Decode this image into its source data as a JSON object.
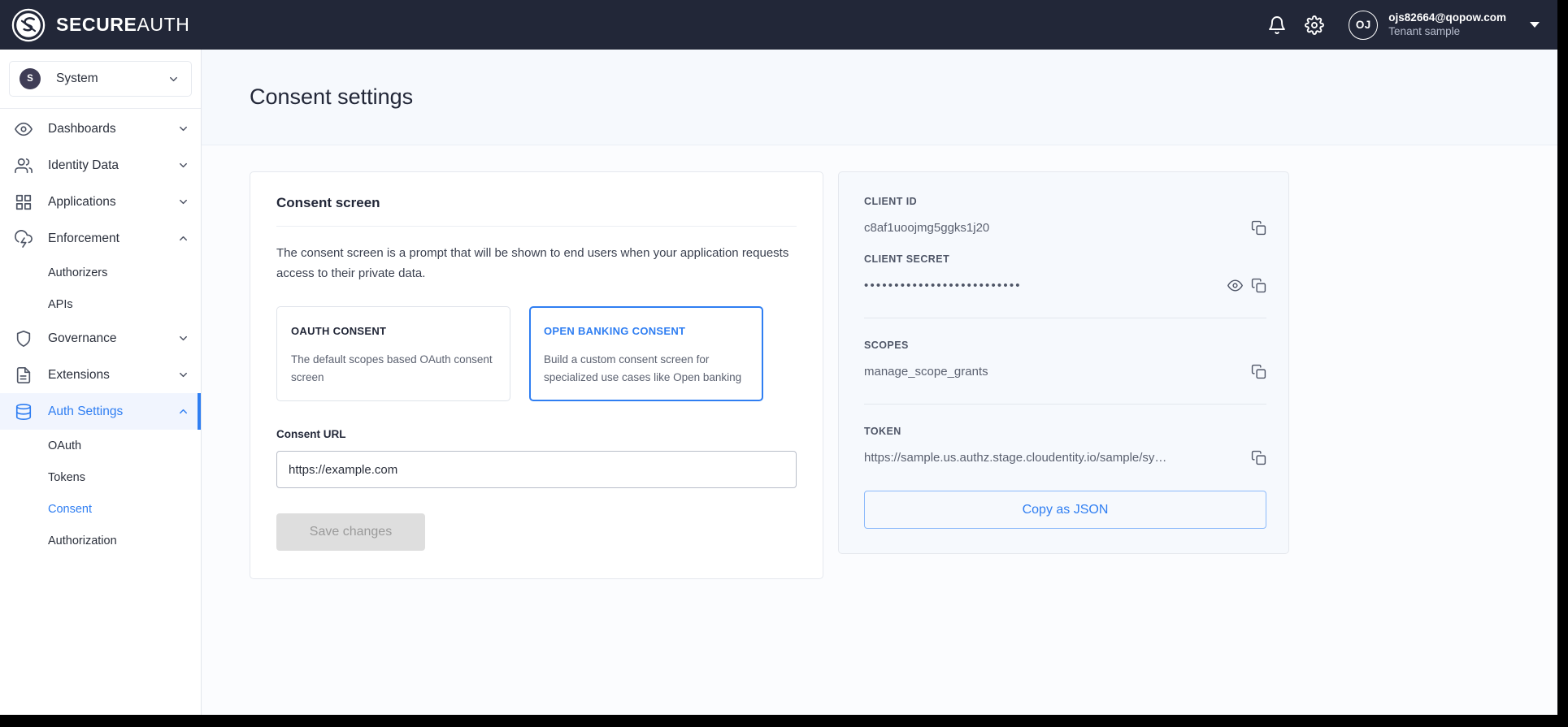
{
  "topbar": {
    "brand_bold": "SECURE",
    "brand_light": "AUTH",
    "logo_icon": "secureauth-logo-icon",
    "notifications_icon": "bell-icon",
    "settings_icon": "gear-icon",
    "avatar_initials": "OJ",
    "user_email": "ojs82664@qopow.com",
    "tenant_line": "Tenant sample"
  },
  "sidebar": {
    "tenant": {
      "initial": "S",
      "label": "System"
    },
    "items": [
      {
        "label": "Dashboards",
        "icon": "eye-icon",
        "expanded": false
      },
      {
        "label": "Identity Data",
        "icon": "users-icon",
        "expanded": false
      },
      {
        "label": "Applications",
        "icon": "grid-icon",
        "expanded": false
      },
      {
        "label": "Enforcement",
        "icon": "cloud-lightning-icon",
        "expanded": true
      },
      {
        "label": "Governance",
        "icon": "shield-icon",
        "expanded": false
      },
      {
        "label": "Extensions",
        "icon": "file-text-icon",
        "expanded": false
      },
      {
        "label": "Auth Settings",
        "icon": "database-icon",
        "expanded": true
      }
    ],
    "enforcement_children": [
      "Authorizers",
      "APIs"
    ],
    "auth_settings_children": [
      "OAuth",
      "Tokens",
      "Consent",
      "Authorization"
    ],
    "active_item": "Auth Settings",
    "selected_child": "Consent"
  },
  "page": {
    "title": "Consent settings"
  },
  "consent_card": {
    "title": "Consent screen",
    "description": "The consent screen is a prompt that will be shown to end users when your application requests access to their private data.",
    "options": [
      {
        "title": "OAUTH CONSENT",
        "description": "The default scopes based OAuth consent screen",
        "selected": false
      },
      {
        "title": "OPEN BANKING CONSENT",
        "description": "Build a custom consent screen for specialized use cases like Open banking",
        "selected": true
      }
    ],
    "url_label": "Consent URL",
    "url_value": "https://example.com",
    "url_placeholder": "https://example.com",
    "save_label": "Save changes"
  },
  "details_card": {
    "client_id_label": "CLIENT ID",
    "client_id_value": "c8af1uoojmg5ggks1j20",
    "client_secret_label": "CLIENT SECRET",
    "client_secret_masked": "••••••••••••••••••••••••••",
    "scopes_label": "SCOPES",
    "scopes_value": "manage_scope_grants",
    "token_label": "TOKEN",
    "token_value": "https://sample.us.authz.stage.cloudentity.io/sample/sy…",
    "copy_icon": "copy-icon",
    "reveal_icon": "eye-icon",
    "copy_json_label": "Copy as JSON"
  },
  "colors": {
    "topbar_bg": "#222738",
    "accent": "#2f7ef2",
    "panel_bg": "#f6f9fd",
    "disabled_btn": "#dedede"
  }
}
